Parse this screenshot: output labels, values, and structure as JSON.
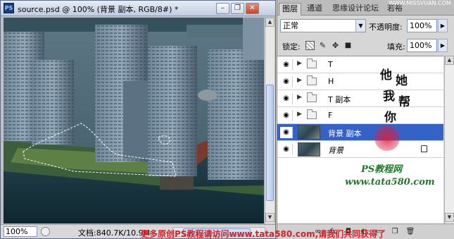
{
  "document": {
    "app_icon": "PS",
    "title": "source.psd @ 100% (背景 副本, RGB/8#) *",
    "window_buttons": {
      "minimize": "–",
      "restore": "❐",
      "close": "✕"
    },
    "zoom": "100%",
    "doc_info": "文档:840.7K/10.9M"
  },
  "panel": {
    "tabs": [
      "图层",
      "通道",
      "思缘设计论坛",
      "若裕"
    ],
    "blend_mode": "正常",
    "opacity_label": "不透明度:",
    "opacity_value": "100%",
    "lock_label": "锁定:",
    "fill_label": "填充:",
    "fill_value": "100%",
    "lock_icons": [
      "transparency-lock-icon",
      "brush-lock-icon",
      "move-lock-icon",
      "all-lock-icon"
    ],
    "layers": [
      {
        "name": "T",
        "type": "group",
        "visible": true
      },
      {
        "name": "H",
        "type": "group",
        "visible": true
      },
      {
        "name": "T 副本",
        "type": "group",
        "visible": true
      },
      {
        "name": "F",
        "type": "group",
        "visible": true
      },
      {
        "name": "背景 副本",
        "type": "image",
        "visible": true,
        "selected": true
      },
      {
        "name": "背景",
        "type": "image",
        "visible": true,
        "locked": true
      }
    ],
    "bottom_icons": [
      "link-icon",
      "fx-icon",
      "mask-icon",
      "adjustment-icon",
      "group-icon",
      "new-layer-icon",
      "delete-icon"
    ]
  },
  "overlays": {
    "top_watermark": "WWW.MISSVUAN.COM",
    "stamp_chars": [
      "他",
      "她",
      "我",
      "帮",
      "你"
    ],
    "ps_net": "PS教程网",
    "ps_url": "www.tata580.com",
    "bottom_watermark": "更多原创PS教程请访问www.tata580.com,请我们共同获得了"
  }
}
